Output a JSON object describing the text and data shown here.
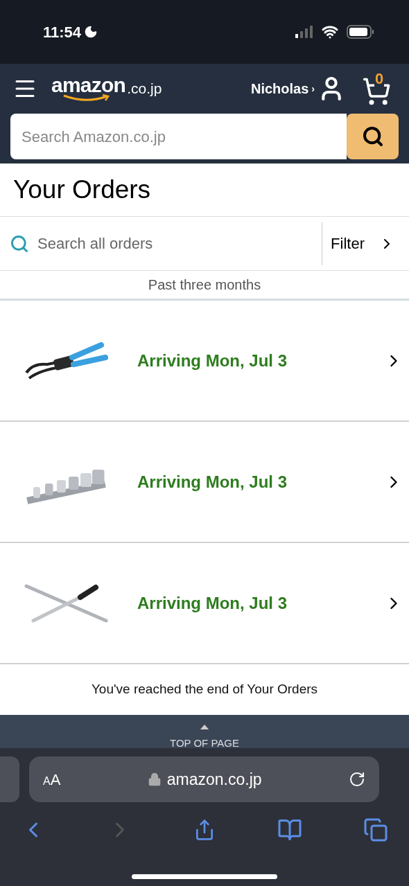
{
  "status_bar": {
    "time": "11:54"
  },
  "header": {
    "logo": "amazon",
    "logo_suffix": ".co.jp",
    "account": "Nicholas",
    "account_caret": "›",
    "cart_count": "0",
    "search": {
      "placeholder": "Search Amazon.co.jp"
    }
  },
  "page": {
    "title": "Your Orders",
    "order_search": {
      "placeholder": "Search all orders"
    },
    "filter": "Filter",
    "period": "Past three months",
    "orders": [
      {
        "kind": "pliers",
        "status": "Arriving Mon, Jul 3"
      },
      {
        "kind": "sockets",
        "status": "Arriving Mon, Jul 3"
      },
      {
        "kind": "wrench",
        "status": "Arriving Mon, Jul 3"
      }
    ],
    "end_note": "You've reached the end of Your Orders",
    "back_to_top": "TOP OF PAGE"
  },
  "browser": {
    "text_size": "AA",
    "address": "amazon.co.jp",
    "back_enabled": true,
    "forward_enabled": false
  }
}
